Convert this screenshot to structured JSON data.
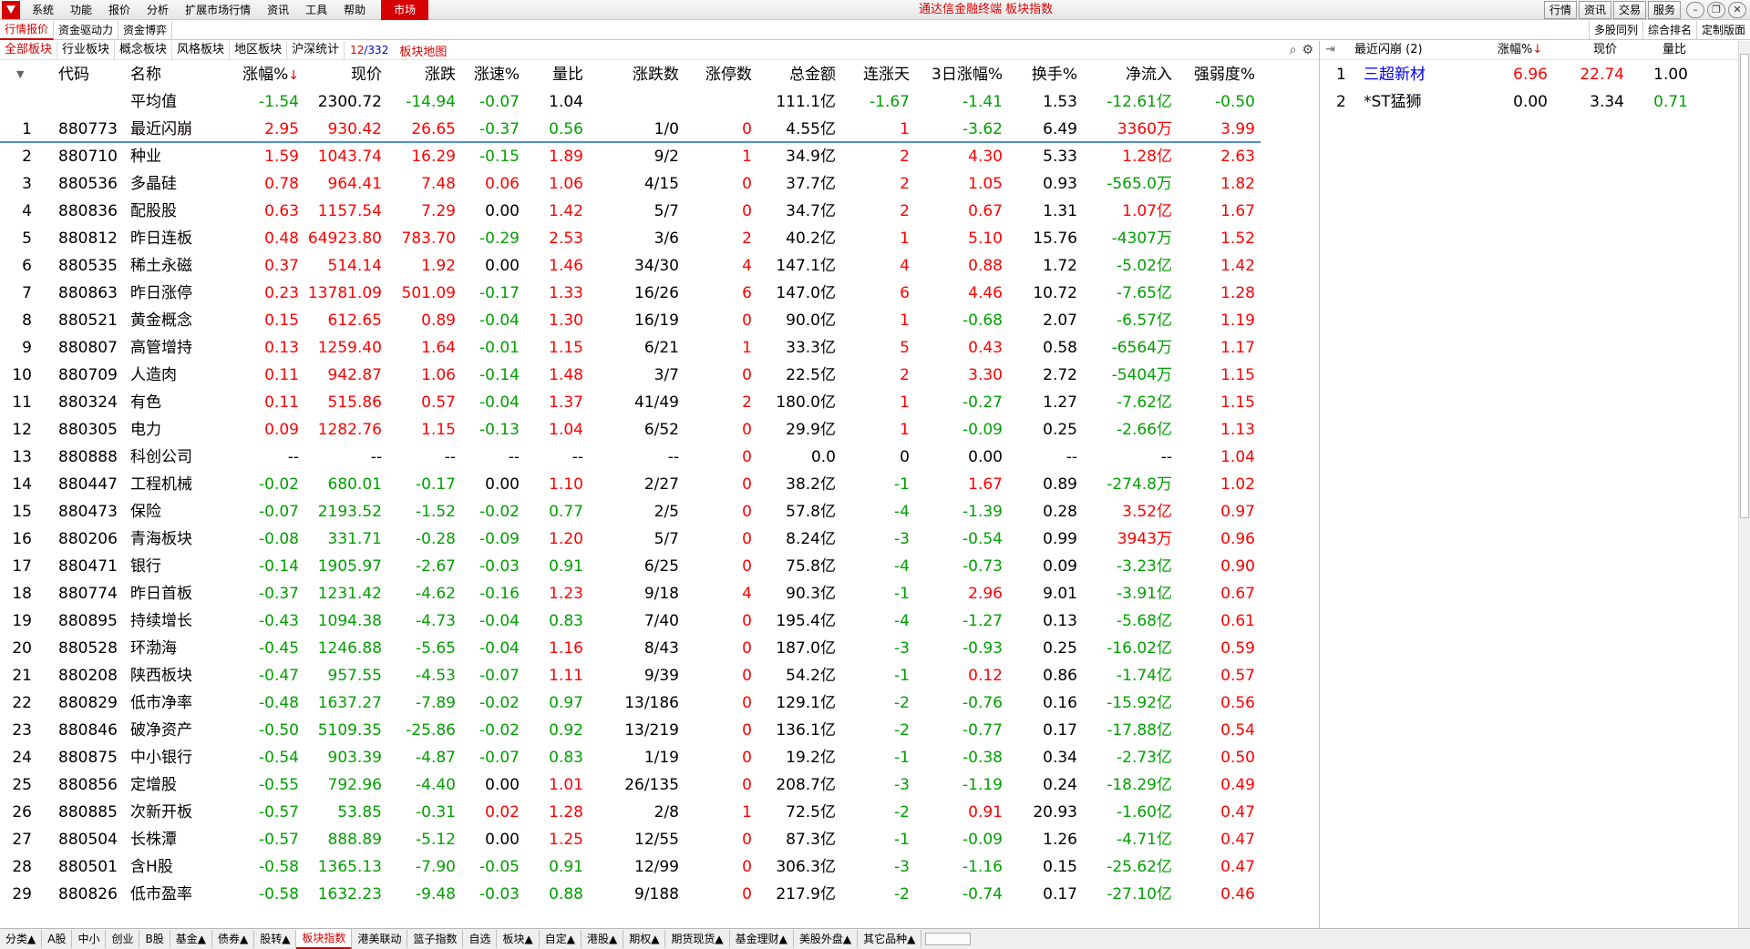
{
  "menubar": {
    "items": [
      "系统",
      "功能",
      "报价",
      "分析",
      "扩展市场行情",
      "资讯",
      "工具",
      "帮助"
    ],
    "market": "市场",
    "title": "通达信金融终端 板块指数",
    "right_buttons": [
      "行情",
      "资讯",
      "交易",
      "服务"
    ]
  },
  "row2": {
    "tabs": [
      "行情报价",
      "资金驱动力",
      "资金博弈"
    ],
    "right_tabs": [
      "多股同列",
      "综合排名",
      "定制版面"
    ]
  },
  "row3": {
    "tabs": [
      "全部板块",
      "行业板块",
      "概念板块",
      "风格板块",
      "地区板块",
      "沪深统计"
    ],
    "count_current": "12",
    "count_total": "/332",
    "sector_map": "板块地图"
  },
  "table": {
    "headers": [
      "代码",
      "名称",
      "涨幅%",
      "现价",
      "涨跌",
      "涨速%",
      "量比",
      "涨跌数",
      "涨停数",
      "总金额",
      "连涨天",
      "3日涨幅%",
      "换手%",
      "净流入",
      "强弱度%"
    ],
    "sort_arrow": "↓",
    "average": {
      "name": "平均值",
      "cells": [
        "-1.54",
        "2300.72",
        "-14.94",
        "-0.07",
        "1.04",
        "",
        "",
        "111.1亿",
        "-1.67",
        "-1.41",
        "1.53",
        "-12.61亿",
        "-0.50"
      ],
      "colors": [
        "g",
        "k",
        "g",
        "g",
        "k",
        "",
        "",
        "k",
        "g",
        "g",
        "k",
        "g",
        "g"
      ]
    },
    "rows": [
      {
        "no": "1",
        "code": "880773",
        "name": "最近闪崩",
        "cells": [
          "2.95",
          "930.42",
          "26.65",
          "-0.37",
          "0.56",
          "1/0",
          "0",
          "4.55亿",
          "1",
          "-3.62",
          "6.49",
          "3360万",
          "3.99"
        ],
        "colors": [
          "r",
          "r",
          "r",
          "g",
          "g",
          "k",
          "r",
          "k",
          "r",
          "g",
          "k",
          "r",
          "r"
        ]
      },
      {
        "no": "2",
        "code": "880710",
        "name": "种业",
        "cells": [
          "1.59",
          "1043.74",
          "16.29",
          "-0.15",
          "1.89",
          "9/2",
          "1",
          "34.9亿",
          "2",
          "4.30",
          "5.33",
          "1.28亿",
          "2.63"
        ],
        "colors": [
          "r",
          "r",
          "r",
          "g",
          "r",
          "k",
          "r",
          "k",
          "r",
          "r",
          "k",
          "r",
          "r"
        ]
      },
      {
        "no": "3",
        "code": "880536",
        "name": "多晶硅",
        "cells": [
          "0.78",
          "964.41",
          "7.48",
          "0.06",
          "1.06",
          "4/15",
          "0",
          "37.7亿",
          "2",
          "1.05",
          "0.93",
          "-565.0万",
          "1.82"
        ],
        "colors": [
          "r",
          "r",
          "r",
          "r",
          "r",
          "k",
          "r",
          "k",
          "r",
          "r",
          "k",
          "g",
          "r"
        ]
      },
      {
        "no": "4",
        "code": "880836",
        "name": "配股股",
        "cells": [
          "0.63",
          "1157.54",
          "7.29",
          "0.00",
          "1.42",
          "5/7",
          "0",
          "34.7亿",
          "2",
          "0.67",
          "1.31",
          "1.07亿",
          "1.67"
        ],
        "colors": [
          "r",
          "r",
          "r",
          "k",
          "r",
          "k",
          "r",
          "k",
          "r",
          "r",
          "k",
          "r",
          "r"
        ]
      },
      {
        "no": "5",
        "code": "880812",
        "name": "昨日连板",
        "cells": [
          "0.48",
          "64923.80",
          "783.70",
          "-0.29",
          "2.53",
          "3/6",
          "2",
          "40.2亿",
          "1",
          "5.10",
          "15.76",
          "-4307万",
          "1.52"
        ],
        "colors": [
          "r",
          "r",
          "r",
          "g",
          "r",
          "k",
          "r",
          "k",
          "r",
          "r",
          "k",
          "g",
          "r"
        ]
      },
      {
        "no": "6",
        "code": "880535",
        "name": "稀土永磁",
        "cells": [
          "0.37",
          "514.14",
          "1.92",
          "0.00",
          "1.46",
          "34/30",
          "4",
          "147.1亿",
          "4",
          "0.88",
          "1.72",
          "-5.02亿",
          "1.42"
        ],
        "colors": [
          "r",
          "r",
          "r",
          "k",
          "r",
          "k",
          "r",
          "k",
          "r",
          "r",
          "k",
          "g",
          "r"
        ]
      },
      {
        "no": "7",
        "code": "880863",
        "name": "昨日涨停",
        "cells": [
          "0.23",
          "13781.09",
          "501.09",
          "-0.17",
          "1.33",
          "16/26",
          "6",
          "147.0亿",
          "6",
          "4.46",
          "10.72",
          "-7.65亿",
          "1.28"
        ],
        "colors": [
          "r",
          "r",
          "r",
          "g",
          "r",
          "k",
          "r",
          "k",
          "r",
          "r",
          "k",
          "g",
          "r"
        ]
      },
      {
        "no": "8",
        "code": "880521",
        "name": "黄金概念",
        "cells": [
          "0.15",
          "612.65",
          "0.89",
          "-0.04",
          "1.30",
          "16/19",
          "0",
          "90.0亿",
          "1",
          "-0.68",
          "2.07",
          "-6.57亿",
          "1.19"
        ],
        "colors": [
          "r",
          "r",
          "r",
          "g",
          "r",
          "k",
          "r",
          "k",
          "r",
          "g",
          "k",
          "g",
          "r"
        ]
      },
      {
        "no": "9",
        "code": "880807",
        "name": "高管增持",
        "cells": [
          "0.13",
          "1259.40",
          "1.64",
          "-0.01",
          "1.15",
          "6/21",
          "1",
          "33.3亿",
          "5",
          "0.43",
          "0.58",
          "-6564万",
          "1.17"
        ],
        "colors": [
          "r",
          "r",
          "r",
          "g",
          "r",
          "k",
          "r",
          "k",
          "r",
          "r",
          "k",
          "g",
          "r"
        ]
      },
      {
        "no": "10",
        "code": "880709",
        "name": "人造肉",
        "cells": [
          "0.11",
          "942.87",
          "1.06",
          "-0.14",
          "1.48",
          "3/7",
          "0",
          "22.5亿",
          "2",
          "3.30",
          "2.72",
          "-5404万",
          "1.15"
        ],
        "colors": [
          "r",
          "r",
          "r",
          "g",
          "r",
          "k",
          "r",
          "k",
          "r",
          "r",
          "k",
          "g",
          "r"
        ]
      },
      {
        "no": "11",
        "code": "880324",
        "name": "有色",
        "cells": [
          "0.11",
          "515.86",
          "0.57",
          "-0.04",
          "1.37",
          "41/49",
          "2",
          "180.0亿",
          "1",
          "-0.27",
          "1.27",
          "-7.62亿",
          "1.15"
        ],
        "colors": [
          "r",
          "r",
          "r",
          "g",
          "r",
          "k",
          "r",
          "k",
          "r",
          "g",
          "k",
          "g",
          "r"
        ]
      },
      {
        "no": "12",
        "code": "880305",
        "name": "电力",
        "cells": [
          "0.09",
          "1282.76",
          "1.15",
          "-0.13",
          "1.04",
          "6/52",
          "0",
          "29.9亿",
          "1",
          "-0.09",
          "0.25",
          "-2.66亿",
          "1.13"
        ],
        "colors": [
          "r",
          "r",
          "r",
          "g",
          "r",
          "k",
          "r",
          "k",
          "r",
          "g",
          "k",
          "g",
          "r"
        ]
      },
      {
        "no": "13",
        "code": "880888",
        "name": "科创公司",
        "cells": [
          "--",
          "--",
          "--",
          "--",
          "--",
          "--",
          "0",
          "0.0",
          "0",
          "0.00",
          "--",
          "--",
          "1.04"
        ],
        "colors": [
          "k",
          "k",
          "k",
          "k",
          "k",
          "k",
          "r",
          "k",
          "k",
          "k",
          "k",
          "k",
          "r"
        ]
      },
      {
        "no": "14",
        "code": "880447",
        "name": "工程机械",
        "cells": [
          "-0.02",
          "680.01",
          "-0.17",
          "0.00",
          "1.10",
          "2/27",
          "0",
          "38.2亿",
          "-1",
          "1.67",
          "0.89",
          "-274.8万",
          "1.02"
        ],
        "colors": [
          "g",
          "g",
          "g",
          "k",
          "r",
          "k",
          "r",
          "k",
          "g",
          "r",
          "k",
          "g",
          "r"
        ]
      },
      {
        "no": "15",
        "code": "880473",
        "name": "保险",
        "cells": [
          "-0.07",
          "2193.52",
          "-1.52",
          "-0.02",
          "0.77",
          "2/5",
          "0",
          "57.8亿",
          "-4",
          "-1.39",
          "0.28",
          "3.52亿",
          "0.97"
        ],
        "colors": [
          "g",
          "g",
          "g",
          "g",
          "g",
          "k",
          "r",
          "k",
          "g",
          "g",
          "k",
          "r",
          "r"
        ]
      },
      {
        "no": "16",
        "code": "880206",
        "name": "青海板块",
        "cells": [
          "-0.08",
          "331.71",
          "-0.28",
          "-0.09",
          "1.20",
          "5/7",
          "0",
          "8.24亿",
          "-3",
          "-0.54",
          "0.99",
          "3943万",
          "0.96"
        ],
        "colors": [
          "g",
          "g",
          "g",
          "g",
          "r",
          "k",
          "r",
          "k",
          "g",
          "g",
          "k",
          "r",
          "r"
        ]
      },
      {
        "no": "17",
        "code": "880471",
        "name": "银行",
        "cells": [
          "-0.14",
          "1905.97",
          "-2.67",
          "-0.03",
          "0.91",
          "6/25",
          "0",
          "75.8亿",
          "-4",
          "-0.73",
          "0.09",
          "-3.23亿",
          "0.90"
        ],
        "colors": [
          "g",
          "g",
          "g",
          "g",
          "g",
          "k",
          "r",
          "k",
          "g",
          "g",
          "k",
          "g",
          "r"
        ]
      },
      {
        "no": "18",
        "code": "880774",
        "name": "昨日首板",
        "cells": [
          "-0.37",
          "1231.42",
          "-4.62",
          "-0.16",
          "1.23",
          "9/18",
          "4",
          "90.3亿",
          "-1",
          "2.96",
          "9.01",
          "-3.91亿",
          "0.67"
        ],
        "colors": [
          "g",
          "g",
          "g",
          "g",
          "r",
          "k",
          "r",
          "k",
          "g",
          "r",
          "k",
          "g",
          "r"
        ]
      },
      {
        "no": "19",
        "code": "880895",
        "name": "持续增长",
        "cells": [
          "-0.43",
          "1094.38",
          "-4.73",
          "-0.04",
          "0.83",
          "7/40",
          "0",
          "195.4亿",
          "-4",
          "-1.27",
          "0.13",
          "-5.68亿",
          "0.61"
        ],
        "colors": [
          "g",
          "g",
          "g",
          "g",
          "g",
          "k",
          "r",
          "k",
          "g",
          "g",
          "k",
          "g",
          "r"
        ]
      },
      {
        "no": "20",
        "code": "880528",
        "name": "环渤海",
        "cells": [
          "-0.45",
          "1246.88",
          "-5.65",
          "-0.04",
          "1.16",
          "8/43",
          "0",
          "187.0亿",
          "-3",
          "-0.93",
          "0.25",
          "-16.02亿",
          "0.59"
        ],
        "colors": [
          "g",
          "g",
          "g",
          "g",
          "r",
          "k",
          "r",
          "k",
          "g",
          "g",
          "k",
          "g",
          "r"
        ]
      },
      {
        "no": "21",
        "code": "880208",
        "name": "陕西板块",
        "cells": [
          "-0.47",
          "957.55",
          "-4.53",
          "-0.07",
          "1.11",
          "9/39",
          "0",
          "54.2亿",
          "-1",
          "0.12",
          "0.86",
          "-1.74亿",
          "0.57"
        ],
        "colors": [
          "g",
          "g",
          "g",
          "g",
          "r",
          "k",
          "r",
          "k",
          "g",
          "r",
          "k",
          "g",
          "r"
        ]
      },
      {
        "no": "22",
        "code": "880829",
        "name": "低市净率",
        "cells": [
          "-0.48",
          "1637.27",
          "-7.89",
          "-0.02",
          "0.97",
          "13/186",
          "0",
          "129.1亿",
          "-2",
          "-0.76",
          "0.16",
          "-15.92亿",
          "0.56"
        ],
        "colors": [
          "g",
          "g",
          "g",
          "g",
          "g",
          "k",
          "r",
          "k",
          "g",
          "g",
          "k",
          "g",
          "r"
        ]
      },
      {
        "no": "23",
        "code": "880846",
        "name": "破净资产",
        "cells": [
          "-0.50",
          "5109.35",
          "-25.86",
          "-0.02",
          "0.92",
          "13/219",
          "0",
          "136.1亿",
          "-2",
          "-0.77",
          "0.17",
          "-17.88亿",
          "0.54"
        ],
        "colors": [
          "g",
          "g",
          "g",
          "g",
          "g",
          "k",
          "r",
          "k",
          "g",
          "g",
          "k",
          "g",
          "r"
        ]
      },
      {
        "no": "24",
        "code": "880875",
        "name": "中小银行",
        "cells": [
          "-0.54",
          "903.39",
          "-4.87",
          "-0.07",
          "0.83",
          "1/19",
          "0",
          "19.2亿",
          "-1",
          "-0.38",
          "0.34",
          "-2.73亿",
          "0.50"
        ],
        "colors": [
          "g",
          "g",
          "g",
          "g",
          "g",
          "k",
          "r",
          "k",
          "g",
          "g",
          "k",
          "g",
          "r"
        ]
      },
      {
        "no": "25",
        "code": "880856",
        "name": "定增股",
        "cells": [
          "-0.55",
          "792.96",
          "-4.40",
          "0.00",
          "1.01",
          "26/135",
          "0",
          "208.7亿",
          "-3",
          "-1.19",
          "0.24",
          "-18.29亿",
          "0.49"
        ],
        "colors": [
          "g",
          "g",
          "g",
          "k",
          "r",
          "k",
          "r",
          "k",
          "g",
          "g",
          "k",
          "g",
          "r"
        ]
      },
      {
        "no": "26",
        "code": "880885",
        "name": "次新开板",
        "cells": [
          "-0.57",
          "53.85",
          "-0.31",
          "0.02",
          "1.28",
          "2/8",
          "1",
          "72.5亿",
          "-2",
          "0.91",
          "20.93",
          "-1.60亿",
          "0.47"
        ],
        "colors": [
          "g",
          "g",
          "g",
          "r",
          "r",
          "k",
          "r",
          "k",
          "g",
          "r",
          "k",
          "g",
          "r"
        ]
      },
      {
        "no": "27",
        "code": "880504",
        "name": "长株潭",
        "cells": [
          "-0.57",
          "888.89",
          "-5.12",
          "0.00",
          "1.25",
          "12/55",
          "0",
          "87.3亿",
          "-1",
          "-0.09",
          "1.26",
          "-4.71亿",
          "0.47"
        ],
        "colors": [
          "g",
          "g",
          "g",
          "k",
          "r",
          "k",
          "r",
          "k",
          "g",
          "g",
          "k",
          "g",
          "r"
        ]
      },
      {
        "no": "28",
        "code": "880501",
        "name": "含H股",
        "cells": [
          "-0.58",
          "1365.13",
          "-7.90",
          "-0.05",
          "0.91",
          "12/99",
          "0",
          "306.3亿",
          "-3",
          "-1.16",
          "0.15",
          "-25.62亿",
          "0.47"
        ],
        "colors": [
          "g",
          "g",
          "g",
          "g",
          "g",
          "k",
          "r",
          "k",
          "g",
          "g",
          "k",
          "g",
          "r"
        ]
      },
      {
        "no": "29",
        "code": "880826",
        "name": "低市盈率",
        "cells": [
          "-0.58",
          "1632.23",
          "-9.48",
          "-0.03",
          "0.88",
          "9/188",
          "0",
          "217.9亿",
          "-2",
          "-0.74",
          "0.17",
          "-27.10亿",
          "0.46"
        ],
        "colors": [
          "g",
          "g",
          "g",
          "g",
          "g",
          "k",
          "r",
          "k",
          "g",
          "g",
          "k",
          "g",
          "r"
        ]
      }
    ]
  },
  "right_panel": {
    "title": "最近闪崩 (2)",
    "headers": [
      "涨幅%",
      "现价",
      "量比"
    ],
    "sort_arrow": "↓",
    "rows": [
      {
        "no": "1",
        "name": "三超新材",
        "change": "6.96",
        "price": "22.74",
        "ratio": "1.00"
      },
      {
        "no": "2",
        "name": "*ST猛狮",
        "change": "0.00",
        "price": "3.34",
        "ratio": "0.71"
      }
    ]
  },
  "bottombar": {
    "tabs": [
      "分类▲",
      "A股",
      "中小",
      "创业",
      "B股",
      "基金▲",
      "债券▲",
      "股转▲",
      "板块指数",
      "港美联动",
      "篮子指数",
      "自选",
      "板块▲",
      "自定▲",
      "港股▲",
      "期权▲",
      "期货现货▲",
      "基金理财▲",
      "美股外盘▲",
      "其它品种▲"
    ],
    "active_index": 8
  },
  "colors": {
    "up": "#ff0000",
    "down": "#00a000",
    "accent": "#d60000",
    "link": "#0000ff"
  }
}
